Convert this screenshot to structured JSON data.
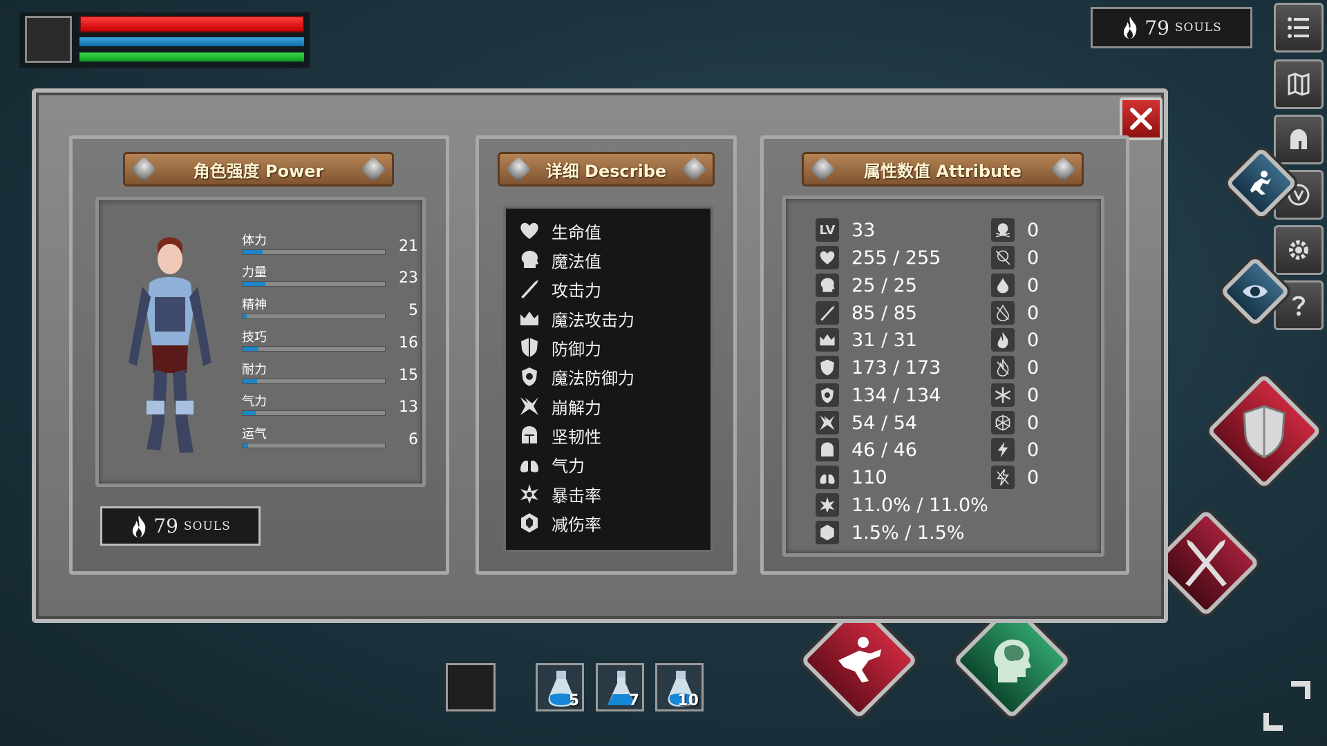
{
  "hud": {
    "health_fill": 1.0,
    "mana_fill": 1.0,
    "stamina_fill": 1.0,
    "souls_count": "79",
    "souls_label": "SOULS"
  },
  "menu": [
    "list-icon",
    "map-icon",
    "helmet-icon",
    "shield-emblem-icon",
    "gear-icon",
    "help-icon"
  ],
  "power": {
    "title": "角色强度 Power",
    "stats": [
      {
        "label": "体力",
        "value": "21",
        "fill": 0.14
      },
      {
        "label": "力量",
        "value": "23",
        "fill": 0.16
      },
      {
        "label": "精神",
        "value": "5",
        "fill": 0.03
      },
      {
        "label": "技巧",
        "value": "16",
        "fill": 0.11
      },
      {
        "label": "耐力",
        "value": "15",
        "fill": 0.1
      },
      {
        "label": "气力",
        "value": "13",
        "fill": 0.09
      },
      {
        "label": "运气",
        "value": "6",
        "fill": 0.04
      }
    ],
    "souls_count": "79",
    "souls_label": "SOULS"
  },
  "describe": {
    "title": "详细 Describe",
    "items": [
      {
        "label": "生命值",
        "icon": "heart-icon"
      },
      {
        "label": "魔法值",
        "icon": "head-icon"
      },
      {
        "label": "攻击力",
        "icon": "sword-icon"
      },
      {
        "label": "魔法攻击力",
        "icon": "magic-crown-icon"
      },
      {
        "label": "防御力",
        "icon": "shield-icon"
      },
      {
        "label": "魔法防御力",
        "icon": "magic-shield-icon"
      },
      {
        "label": "崩解力",
        "icon": "break-icon"
      },
      {
        "label": "坚韧性",
        "icon": "helm-icon"
      },
      {
        "label": "气力",
        "icon": "lungs-icon"
      },
      {
        "label": "暴击率",
        "icon": "crit-icon"
      },
      {
        "label": "减伤率",
        "icon": "reduce-icon"
      }
    ]
  },
  "attribute": {
    "title": "属性数值 Attribute",
    "lv_label": "LV",
    "left": [
      "33",
      "255 / 255",
      "25 / 25",
      "85 / 85",
      "31 / 31",
      "173 / 173",
      "134 / 134",
      "54 / 54",
      "46 / 46",
      "110",
      "11.0% / 11.0%",
      "1.5% / 1.5%"
    ],
    "right": [
      "0",
      "0",
      "0",
      "0",
      "0",
      "0",
      "0",
      "0",
      "0",
      "0"
    ]
  },
  "hotbar": [
    {
      "count": "5"
    },
    {
      "count": "7"
    },
    {
      "count": "10"
    }
  ]
}
